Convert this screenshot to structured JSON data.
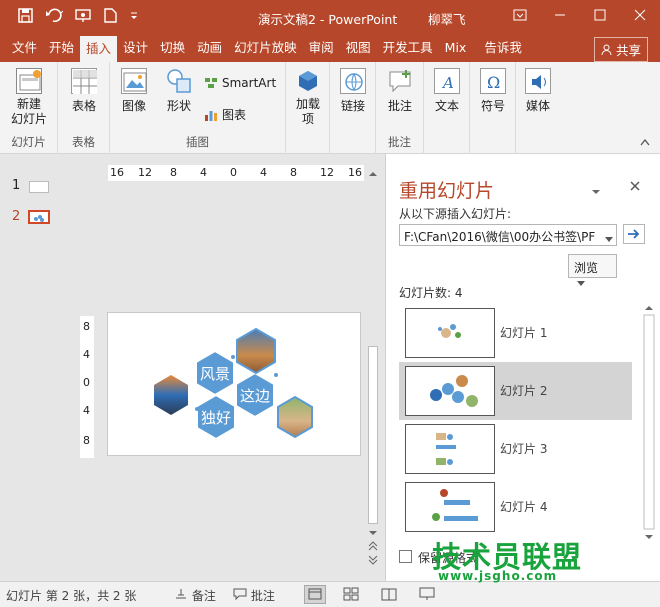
{
  "window": {
    "title": "演示文稿2 - PowerPoint",
    "user": "柳翠飞",
    "controls": [
      "ribbon-options",
      "minimize",
      "maximize",
      "close"
    ]
  },
  "quick_access": [
    "save-icon",
    "undo-icon",
    "present-icon",
    "new-icon",
    "customize-icon"
  ],
  "tabs": [
    {
      "label": "文件"
    },
    {
      "label": "开始"
    },
    {
      "label": "插入",
      "active": true
    },
    {
      "label": "设计"
    },
    {
      "label": "切换"
    },
    {
      "label": "动画"
    },
    {
      "label": "幻灯片放映"
    },
    {
      "label": "审阅"
    },
    {
      "label": "视图"
    },
    {
      "label": "开发工具"
    },
    {
      "label": "Mix"
    },
    {
      "label": "告诉我"
    }
  ],
  "share_label": "共享",
  "ribbon": {
    "groups": [
      {
        "name": "幻灯片",
        "buttons": [
          "新建\n幻灯片"
        ]
      },
      {
        "name": "表格",
        "buttons": [
          "表格"
        ]
      },
      {
        "name": "插图",
        "buttons": [
          "图像",
          "形状"
        ],
        "small_buttons": [
          "SmartArt",
          "图表"
        ]
      },
      {
        "name": "",
        "buttons": [
          "加载\n项"
        ]
      },
      {
        "name": "",
        "buttons": [
          "链接"
        ]
      },
      {
        "name": "批注",
        "buttons": [
          "批注"
        ]
      },
      {
        "name": "",
        "buttons": [
          "文本",
          "符号",
          "媒体"
        ]
      }
    ]
  },
  "thumbnails": [
    {
      "number": "1"
    },
    {
      "number": "2",
      "selected": true
    }
  ],
  "ruler": {
    "horizontal": [
      "16",
      "12",
      "8",
      "4",
      "0",
      "4",
      "8",
      "12",
      "16"
    ],
    "vertical": [
      "8",
      "4",
      "0",
      "4",
      "8"
    ]
  },
  "slide": {
    "hexagons": [
      {
        "label": "风景"
      },
      {
        "label": "这边"
      },
      {
        "label": "独好"
      }
    ]
  },
  "pane": {
    "title": "重用幻灯片",
    "insert_from_label": "从以下源插入幻灯片:",
    "path_value": "F:\\CFan\\2016\\微信\\00办公书签\\PF",
    "browse_label": "浏览",
    "count_label": "幻灯片数: 4",
    "slides": [
      {
        "label": "幻灯片 1"
      },
      {
        "label": "幻灯片 2",
        "selected": true
      },
      {
        "label": "幻灯片 3"
      },
      {
        "label": "幻灯片 4"
      }
    ],
    "keep_format_label": "保留源格式"
  },
  "statusbar": {
    "slide_info": "幻灯片 第 2 张，共 2 张",
    "notes_label": "备注",
    "comments_label": "批注"
  },
  "watermark": {
    "text": "技术员联盟",
    "url": "www.jsgho.com"
  },
  "colors": {
    "accent": "#b7472a",
    "hex_fill": "#5b9bd5",
    "watermark": "#19a33c"
  }
}
